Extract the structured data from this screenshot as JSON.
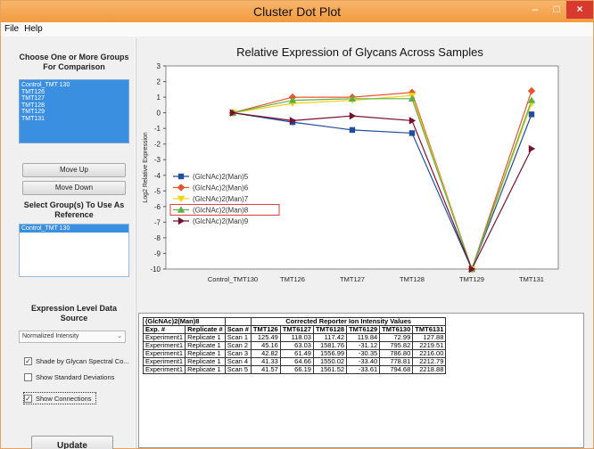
{
  "window": {
    "title": "Cluster Dot Plot",
    "minimize": "–",
    "maximize": "□",
    "close": "×"
  },
  "menu": [
    "File",
    "Help"
  ],
  "left_panel": {
    "groups_title": "Choose One or More Groups For Comparison",
    "groups": [
      "Control_TMT 130",
      "TMT126",
      "TMT127",
      "TMT128",
      "TMT129",
      "TMT131"
    ],
    "move_up": "Move Up",
    "move_down": "Move Down",
    "reference_title": "Select Group(s) To Use As Reference",
    "reference_groups": [
      "Control_TMT 130"
    ],
    "expression_title": "Expression Level Data Source",
    "expression_value": "Normalized Intensity",
    "options": [
      {
        "label": "Shade by Glycan Spectral Co...",
        "checked": true
      },
      {
        "label": "Show Standard Deviations",
        "checked": false
      },
      {
        "label": "Show Connections",
        "checked": true
      }
    ],
    "update": "Update"
  },
  "chart_data": {
    "type": "line",
    "title": "Relative Expression of Glycans Across Samples",
    "ylabel": "Log2 Relative Expression",
    "xlabel": "",
    "categories": [
      "Control_TMT130",
      "TMT126",
      "TMT127",
      "TMT128",
      "TMT129",
      "TMT131"
    ],
    "ylim": [
      -10,
      3
    ],
    "yticks": [
      3,
      2,
      1,
      0,
      -1,
      -2,
      -3,
      -4,
      -5,
      -6,
      -7,
      -8,
      -9,
      -10
    ],
    "grid": false,
    "legend": "left",
    "series": [
      {
        "name": "(GlcNAc)2(Man)5",
        "color": "#1f4e9c",
        "marker": "square",
        "values": [
          0,
          -0.6,
          -1.1,
          -1.3,
          -10,
          -0.1
        ]
      },
      {
        "name": "(GlcNAc)2(Man)6",
        "color": "#e8542a",
        "marker": "diamond",
        "values": [
          0,
          1.0,
          1.0,
          1.3,
          -10,
          1.4
        ]
      },
      {
        "name": "(GlcNAc)2(Man)7",
        "color": "#f2d21a",
        "marker": "triangle-down",
        "values": [
          0,
          0.6,
          0.8,
          1.1,
          -10,
          0.6
        ]
      },
      {
        "name": "(GlcNAc)2(Man)8",
        "color": "#5bb04a",
        "marker": "triangle-up",
        "values": [
          0,
          0.8,
          0.9,
          0.9,
          -10,
          0.8
        ]
      },
      {
        "name": "(GlcNAc)2(Man)9",
        "color": "#7a1030",
        "marker": "triangle-right",
        "values": [
          0,
          -0.5,
          -0.2,
          -0.5,
          -10,
          -2.3
        ]
      }
    ],
    "highlighted_series": "(GlcNAc)2(Man)8"
  },
  "table": {
    "glycan": "(GlcNAc)2(Man)8",
    "header_label": "Corrected Reporter Ion Intensity Values",
    "columns": [
      "Exp. #",
      "Replicate #",
      "Scan #",
      "TMT126",
      "TMT6127",
      "TMT6128",
      "TMT6129",
      "TMT6130",
      "TMT6131"
    ],
    "rows": [
      [
        "Experiment1",
        "Replicate 1",
        "Scan 1",
        "125.49",
        "118.03",
        "117.42",
        "119.84",
        "72.99",
        "127.88"
      ],
      [
        "Experiment1",
        "Replicate 1",
        "Scan 2",
        "45.16",
        "63.03",
        "1581.76",
        "-31.12",
        "795.82",
        "2219.51"
      ],
      [
        "Experiment1",
        "Replicate 1",
        "Scan 3",
        "42.82",
        "61.49",
        "1556.99",
        "-30.35",
        "786.80",
        "2216.00"
      ],
      [
        "Experiment1",
        "Replicate 1",
        "Scan 4",
        "41.33",
        "64.66",
        "1550.02",
        "-33.40",
        "778.81",
        "2212.79"
      ],
      [
        "Experiment1",
        "Replicate 1",
        "Scan 5",
        "41.57",
        "66.19",
        "1561.52",
        "-33.61",
        "794.68",
        "2218.88"
      ]
    ]
  }
}
